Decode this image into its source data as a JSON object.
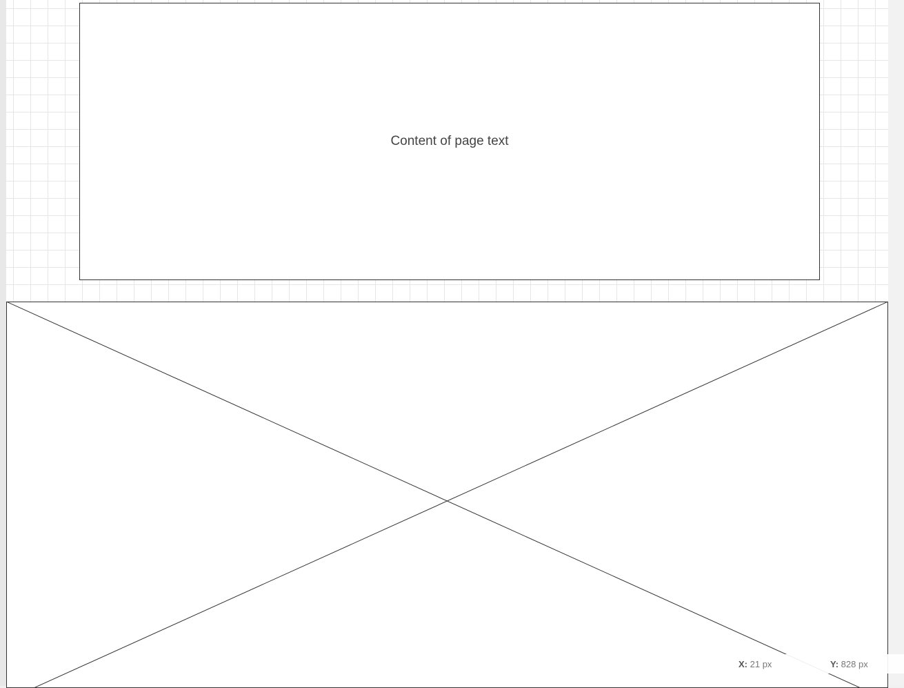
{
  "canvas": {
    "text_box": {
      "text": "Content of page text"
    },
    "image_placeholder": {
      "label": ""
    }
  },
  "status": {
    "x_label": "X:",
    "x_value": "21 px",
    "y_label": "Y:",
    "y_value": "828 px"
  },
  "colors": {
    "grid_line": "#e6e6e6",
    "frame_border": "#333333",
    "text": "#444444"
  }
}
